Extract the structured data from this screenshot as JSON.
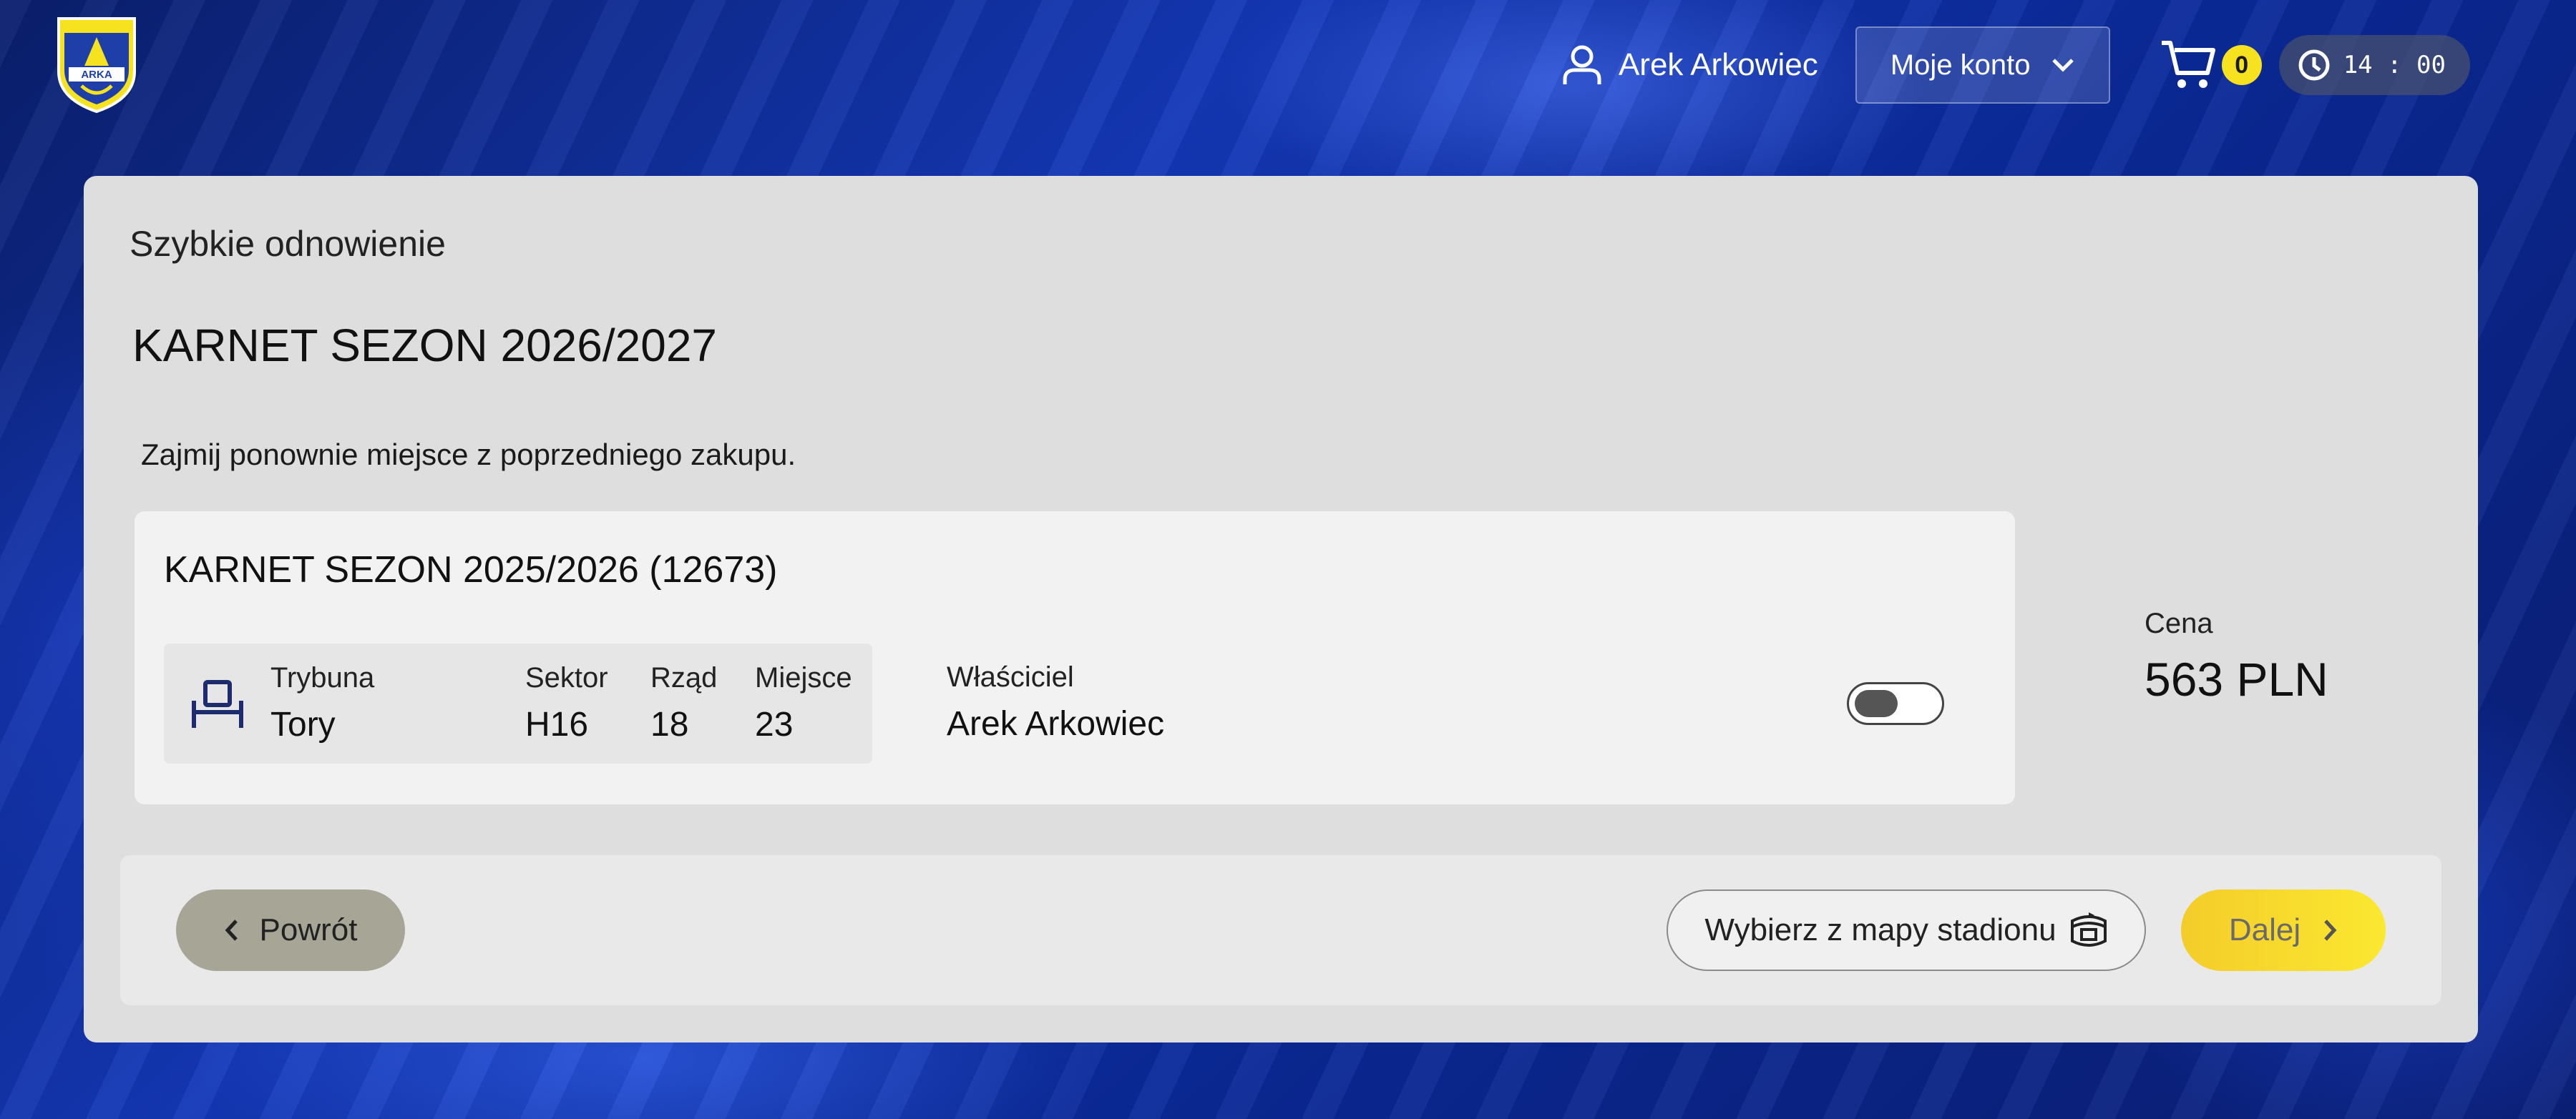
{
  "header": {
    "logo_icon": "arka-club-crest-icon",
    "user_name": "Arek Arkowiec",
    "account_button_label": "Moje konto",
    "cart_count": "0",
    "timer": "14 : 00"
  },
  "panel": {
    "subtitle": "Szybkie odnowienie",
    "title": "KARNET SEZON 2026/2027",
    "description": "Zajmij ponownie miejsce z poprzedniego zakupu."
  },
  "card": {
    "title": "KARNET SEZON 2025/2026 (12673)",
    "stand_label": "Trybuna",
    "stand_value": "Tory",
    "sector_label": "Sektor",
    "sector_value": "H16",
    "row_label": "Rząd",
    "row_value": "18",
    "seat_label": "Miejsce",
    "seat_value": "23",
    "owner_label": "Właściciel",
    "owner_value": "Arek Arkowiec",
    "toggle_on": false
  },
  "price": {
    "label": "Cena",
    "value": "563 PLN"
  },
  "actions": {
    "back_label": "Powrót",
    "map_label": "Wybierz z mapy stadionu",
    "next_label": "Dalej"
  },
  "colors": {
    "accent_yellow": "#f7e21f",
    "back_button": "#a7a595",
    "background_blue": "#1438b8"
  }
}
